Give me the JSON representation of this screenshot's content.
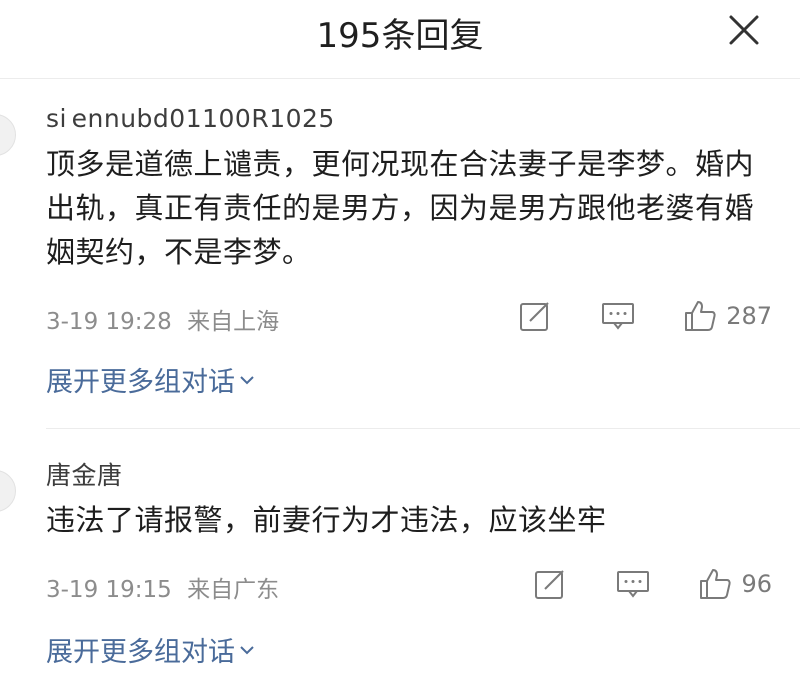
{
  "header": {
    "title": "195条回复"
  },
  "comments": [
    {
      "username": "si ennubd01100R1025",
      "text": "顶多是道德上谴责，更何况现在合法妻子是李梦。婚内出轨，真正有责任的是男方，因为是男方跟他老婆有婚姻契约，不是李梦。",
      "time": "3-19 19:28",
      "location": "来自上海",
      "likes": "287",
      "expand_label": "展开更多组对话"
    },
    {
      "username": "唐金唐",
      "text": "违法了请报警，前妻行为才违法，应该坐牢",
      "time": "3-19 19:15",
      "location": "来自广东",
      "likes": "96",
      "expand_label": "展开更多组对话"
    }
  ],
  "icons": {
    "close": "close-icon",
    "share": "share-icon",
    "comment": "comment-icon",
    "like": "like-icon",
    "chevron": "chevron-down-icon"
  }
}
